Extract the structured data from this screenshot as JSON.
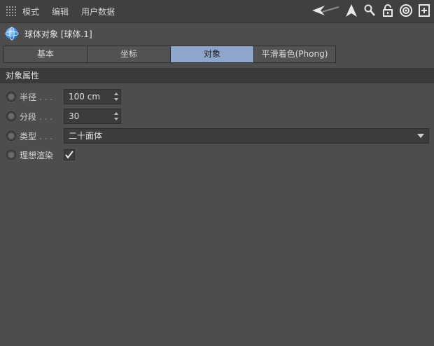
{
  "menubar": {
    "items": [
      "模式",
      "编辑",
      "用户数据"
    ],
    "icons": [
      "grip-icon",
      "arrow-left-icon",
      "arrow-up-icon",
      "search-icon",
      "lock-icon",
      "target-icon",
      "add-panel-icon"
    ]
  },
  "object": {
    "title": "球体对象 [球体.1]",
    "icon": "sphere-icon"
  },
  "tabs": [
    "基本",
    "坐标",
    "对象",
    "平滑着色(Phong)"
  ],
  "active_tab": "对象",
  "section": {
    "title": "对象属性"
  },
  "properties": {
    "radius": {
      "label": "半径",
      "dots": " . . .",
      "value": "100 cm"
    },
    "segments": {
      "label": "分段",
      "dots": " . . .",
      "value": "30"
    },
    "type": {
      "label": "类型",
      "dots": " . . .",
      "value": "二十面体"
    },
    "render": {
      "label": "理想渲染",
      "checked": true
    }
  },
  "colors": {
    "accent_tab": "#8fa6cc",
    "background": "#4d4d4d"
  }
}
